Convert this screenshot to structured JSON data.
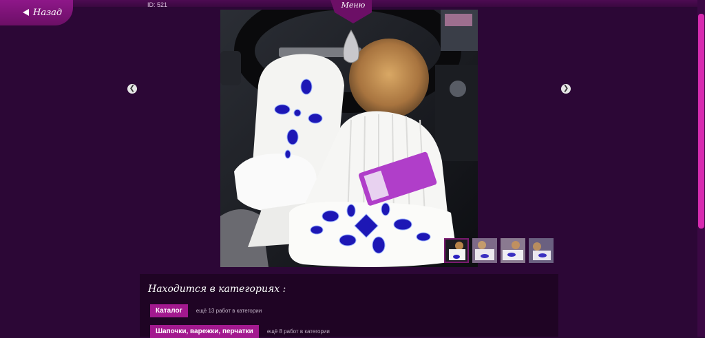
{
  "header": {
    "back_label": "Назад",
    "menu_label": "Меню",
    "id_label": "ID: 521"
  },
  "gallery": {
    "prev_icon": "chevron-left-icon",
    "next_icon": "chevron-right-icon",
    "thumbnails_count": 4,
    "active_thumbnail": 1
  },
  "categories": {
    "title": "Находится в категориях :",
    "items": [
      {
        "label": "Каталог",
        "count_text": "ещё 13 работ в категории"
      },
      {
        "label": "Шапочки, варежки, перчатки",
        "count_text": "ещё 8 работ в категории"
      }
    ]
  },
  "colors": {
    "background": "#2c0736",
    "accent": "#a3198f",
    "scroll_thumb": "#d82bb0"
  }
}
